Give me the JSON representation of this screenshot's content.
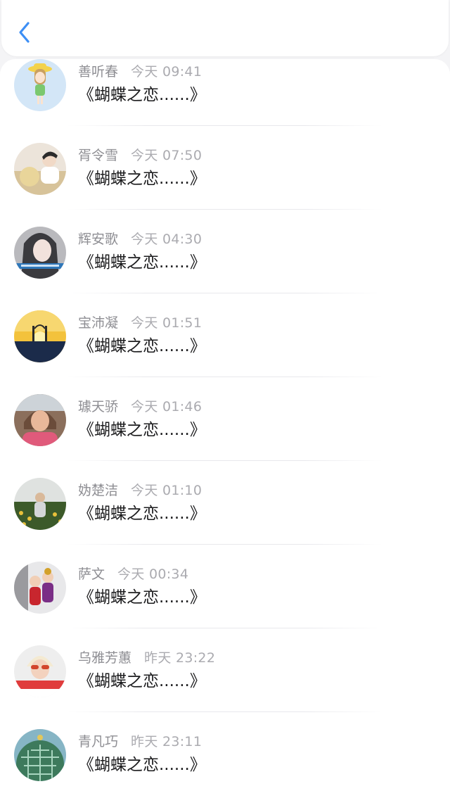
{
  "header": {
    "back_icon": "chevron-left-icon",
    "accent_color": "#3d8ff5"
  },
  "messages": [
    {
      "name": "善听春",
      "time": "今天 09:41",
      "content": "《蝴蝶之恋......》",
      "avatar": "cartoon-girl-avatar"
    },
    {
      "name": "胥令雪",
      "time": "今天 07:50",
      "content": "《蝴蝶之恋......》",
      "avatar": "man-with-flowers-avatar"
    },
    {
      "name": "辉安歌",
      "time": "今天 04:30",
      "content": "《蝴蝶之恋......》",
      "avatar": "girl-portrait-avatar"
    },
    {
      "name": "宝沛凝",
      "time": "今天 01:51",
      "content": "《蝴蝶之恋......》",
      "avatar": "sunset-couple-avatar"
    },
    {
      "name": "璩天骄",
      "time": "今天 01:46",
      "content": "《蝴蝶之恋......》",
      "avatar": "woman-portrait-avatar"
    },
    {
      "name": "妫楚洁",
      "time": "今天 01:10",
      "content": "《蝴蝶之恋......》",
      "avatar": "flower-field-avatar"
    },
    {
      "name": "萨文",
      "time": "今天 00:34",
      "content": "《蝴蝶之恋......》",
      "avatar": "costume-kids-avatar"
    },
    {
      "name": "乌雅芳蕙",
      "time": "昨天 23:22",
      "content": "《蝴蝶之恋......》",
      "avatar": "boy-sunglasses-avatar"
    },
    {
      "name": "青凡巧",
      "time": "昨天 23:11",
      "content": "《蝴蝶之恋......》",
      "avatar": "cactus-avatar"
    }
  ]
}
